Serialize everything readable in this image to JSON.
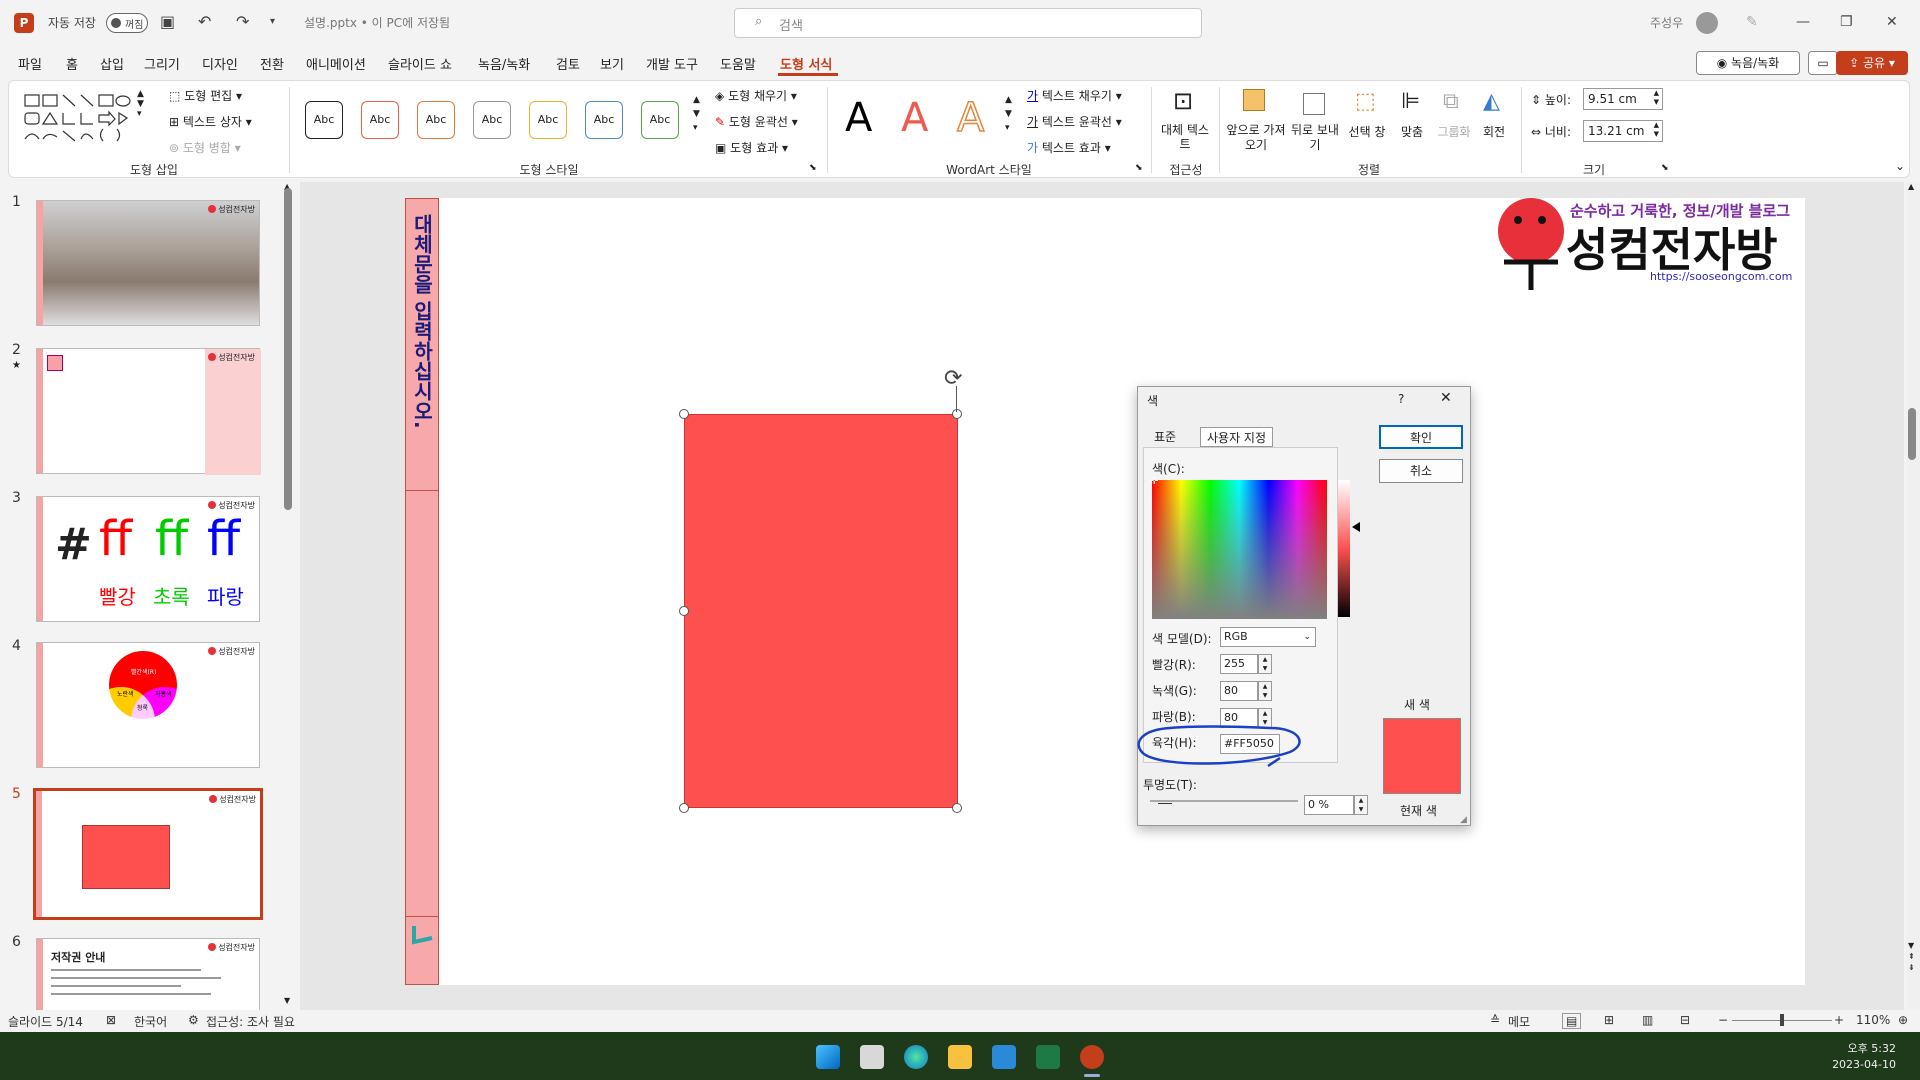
{
  "title_bar": {
    "app_logo": "P",
    "autosave_label": "자동 저장",
    "autosave_state": "꺼짐",
    "filename": "설명.pptx • 이 PC에 저장됨",
    "search_placeholder": "검색",
    "user_name": "주성우"
  },
  "menu": {
    "items": [
      "파일",
      "홈",
      "삽입",
      "그리기",
      "디자인",
      "전환",
      "애니메이션",
      "슬라이드 쇼",
      "녹음/녹화",
      "검토",
      "보기",
      "개발 도구",
      "도움말",
      "도형 서식"
    ],
    "active": "도형 서식",
    "record_button": "녹음/녹화",
    "share_button": "공유"
  },
  "ribbon": {
    "insert_shapes_label": "도형 삽입",
    "edit_shape": "도형 편집",
    "text_box": "텍스트 상자",
    "merge_shapes": "도형 병합",
    "shape_styles_label": "도형 스타일",
    "style_button_text": "Abc",
    "shape_fill": "도형 채우기",
    "shape_outline": "도형 윤곽선",
    "shape_effects": "도형 효과",
    "wordart_label": "WordArt 스타일",
    "text_fill": "텍스트 채우기",
    "text_outline": "텍스트 윤곽선",
    "text_effects": "텍스트 효과",
    "alt_text": "대체 텍스트",
    "accessibility_label": "접근성",
    "bring_forward": "앞으로 가져오기",
    "send_backward": "뒤로 보내기",
    "selection_pane": "선택 창",
    "align": "맞춤",
    "group": "그룹화",
    "rotate": "회전",
    "arrange_label": "정렬",
    "height_label": "높이:",
    "height_value": "9.51 cm",
    "width_label": "너비:",
    "width_value": "13.21 cm",
    "size_label": "크기"
  },
  "thumbnails": {
    "numbers": [
      "1",
      "2",
      "3",
      "4",
      "5",
      "6"
    ],
    "selected": "5",
    "brand_small": "성컴전자방",
    "slide3": {
      "hash": "#",
      "ff": "ff",
      "red": "빨강",
      "green": "초록",
      "blue": "파랑"
    },
    "slide4": {
      "red": "빨간색(R)",
      "green": "초록색(G)",
      "blue": "파란색(B)",
      "yellow": "노란색",
      "magenta": "자홍색",
      "cyan": "청록"
    },
    "slide6_title": "저작권 안내"
  },
  "slide": {
    "vertical_text": "대체문을 입력하십시오.",
    "brand_slogan": "순수하고 거룩한, 정보/개발 블로그",
    "brand_name": "성컴전자방",
    "brand_url": "https://sooseongcom.com",
    "shape_color": "#FF5050"
  },
  "color_dialog": {
    "title": "색",
    "help": "?",
    "close": "✕",
    "tab_standard": "표준",
    "tab_custom": "사용자 지정",
    "color_label": "색(C):",
    "model_label": "색 모델(D):",
    "model_value": "RGB",
    "red_label": "빨강(R):",
    "red_value": "255",
    "green_label": "녹색(G):",
    "green_value": "80",
    "blue_label": "파랑(B):",
    "blue_value": "80",
    "hex_label": "육각(H):",
    "hex_value": "#FF5050",
    "transparency_label": "투명도(T):",
    "transparency_value": "0 %",
    "ok_button": "확인",
    "cancel_button": "취소",
    "new_label": "새 색",
    "current_label": "현재 색",
    "annotation_color": "#1a3fc8"
  },
  "status_bar": {
    "slide_info": "슬라이드 5/14",
    "language": "한국어",
    "accessibility": "접근성: 조사 필요",
    "notes": "메모",
    "zoom": "110%"
  },
  "taskbar": {
    "time": "오후 5:32",
    "date": "2023-04-10"
  }
}
